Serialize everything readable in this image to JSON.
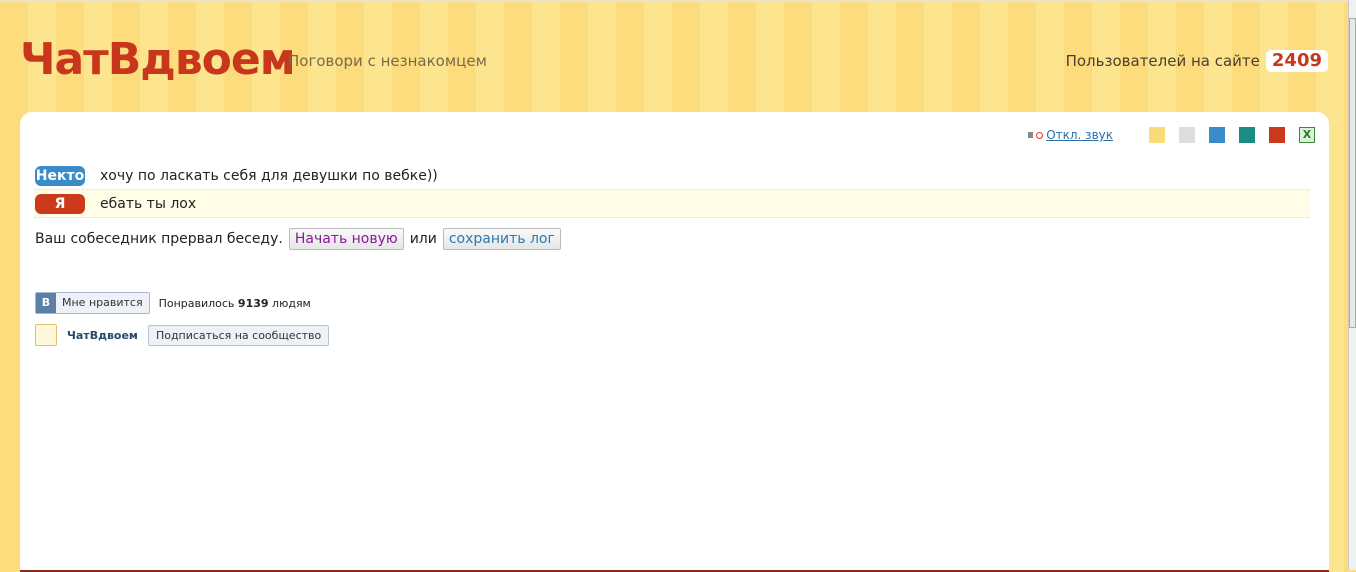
{
  "header": {
    "logo": "ЧатВдвоем",
    "slogan": "Поговори с незнакомцем",
    "users_label": "Пользователей на сайте",
    "users_count": "2409"
  },
  "toolbar": {
    "sound_icon": "speaker-muted-icon",
    "sound_label": "Откл. звук",
    "themes": [
      "#f9dc7a",
      "#dddddd",
      "#3a8cc8",
      "#1e8a86",
      "#cc3a1e"
    ],
    "export_icon": "excel-icon"
  },
  "messages": [
    {
      "author": "Некто",
      "color": "#3a8cc8",
      "text": "хочу по ласкать себя для девушки по вебке))"
    },
    {
      "author": "Я",
      "color": "#cc3a1e",
      "text": "ебать ты лох"
    }
  ],
  "end": {
    "text": "Ваш собеседник прервал беседу.",
    "new_label": "Начать новую",
    "or": "или",
    "save_label": "сохранить лог"
  },
  "vk": {
    "logo": "В",
    "like_label": "Мне нравится",
    "liked_prefix": "Понравилось",
    "liked_count": "9139",
    "liked_suffix": "людям"
  },
  "group": {
    "name": "ЧатВдвоем",
    "subscribe_label": "Подписаться на сообщество"
  }
}
